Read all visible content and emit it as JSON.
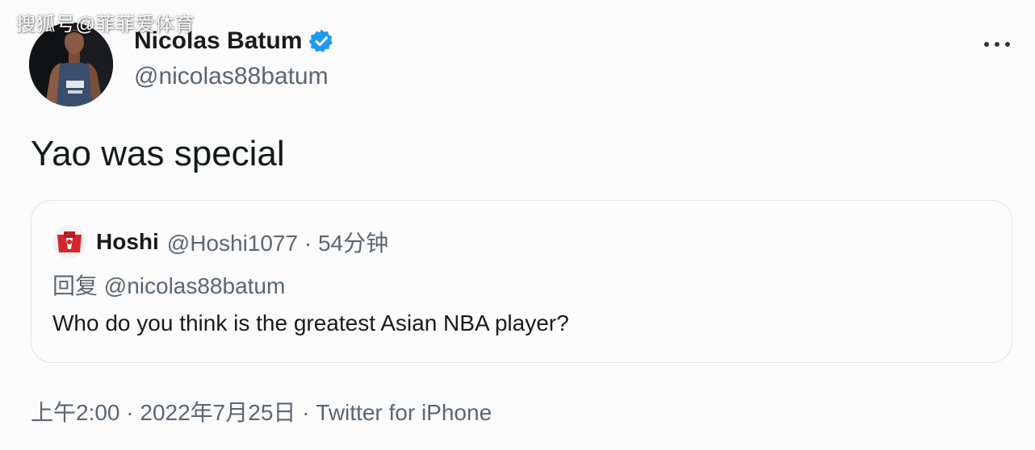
{
  "watermark": "搜狐号@菲菲爱体育",
  "author": {
    "name": "Nicolas Batum",
    "handle": "@nicolas88batum",
    "verified": true
  },
  "more_icon": "more-horizontal-icon",
  "tweet": {
    "text": "Yao was special"
  },
  "quote": {
    "name": "Hoshi",
    "meta": "@Hoshi1077 · 54分钟",
    "reply_to": "回复 @nicolas88batum",
    "text": "Who do you think is the greatest Asian NBA player?"
  },
  "footer": {
    "text": "上午2:00 · 2022年7月25日 · Twitter for iPhone"
  },
  "colors": {
    "verified": "#1d9bf0",
    "secondary_text": "#5b6670",
    "border": "#dfe3e7"
  }
}
